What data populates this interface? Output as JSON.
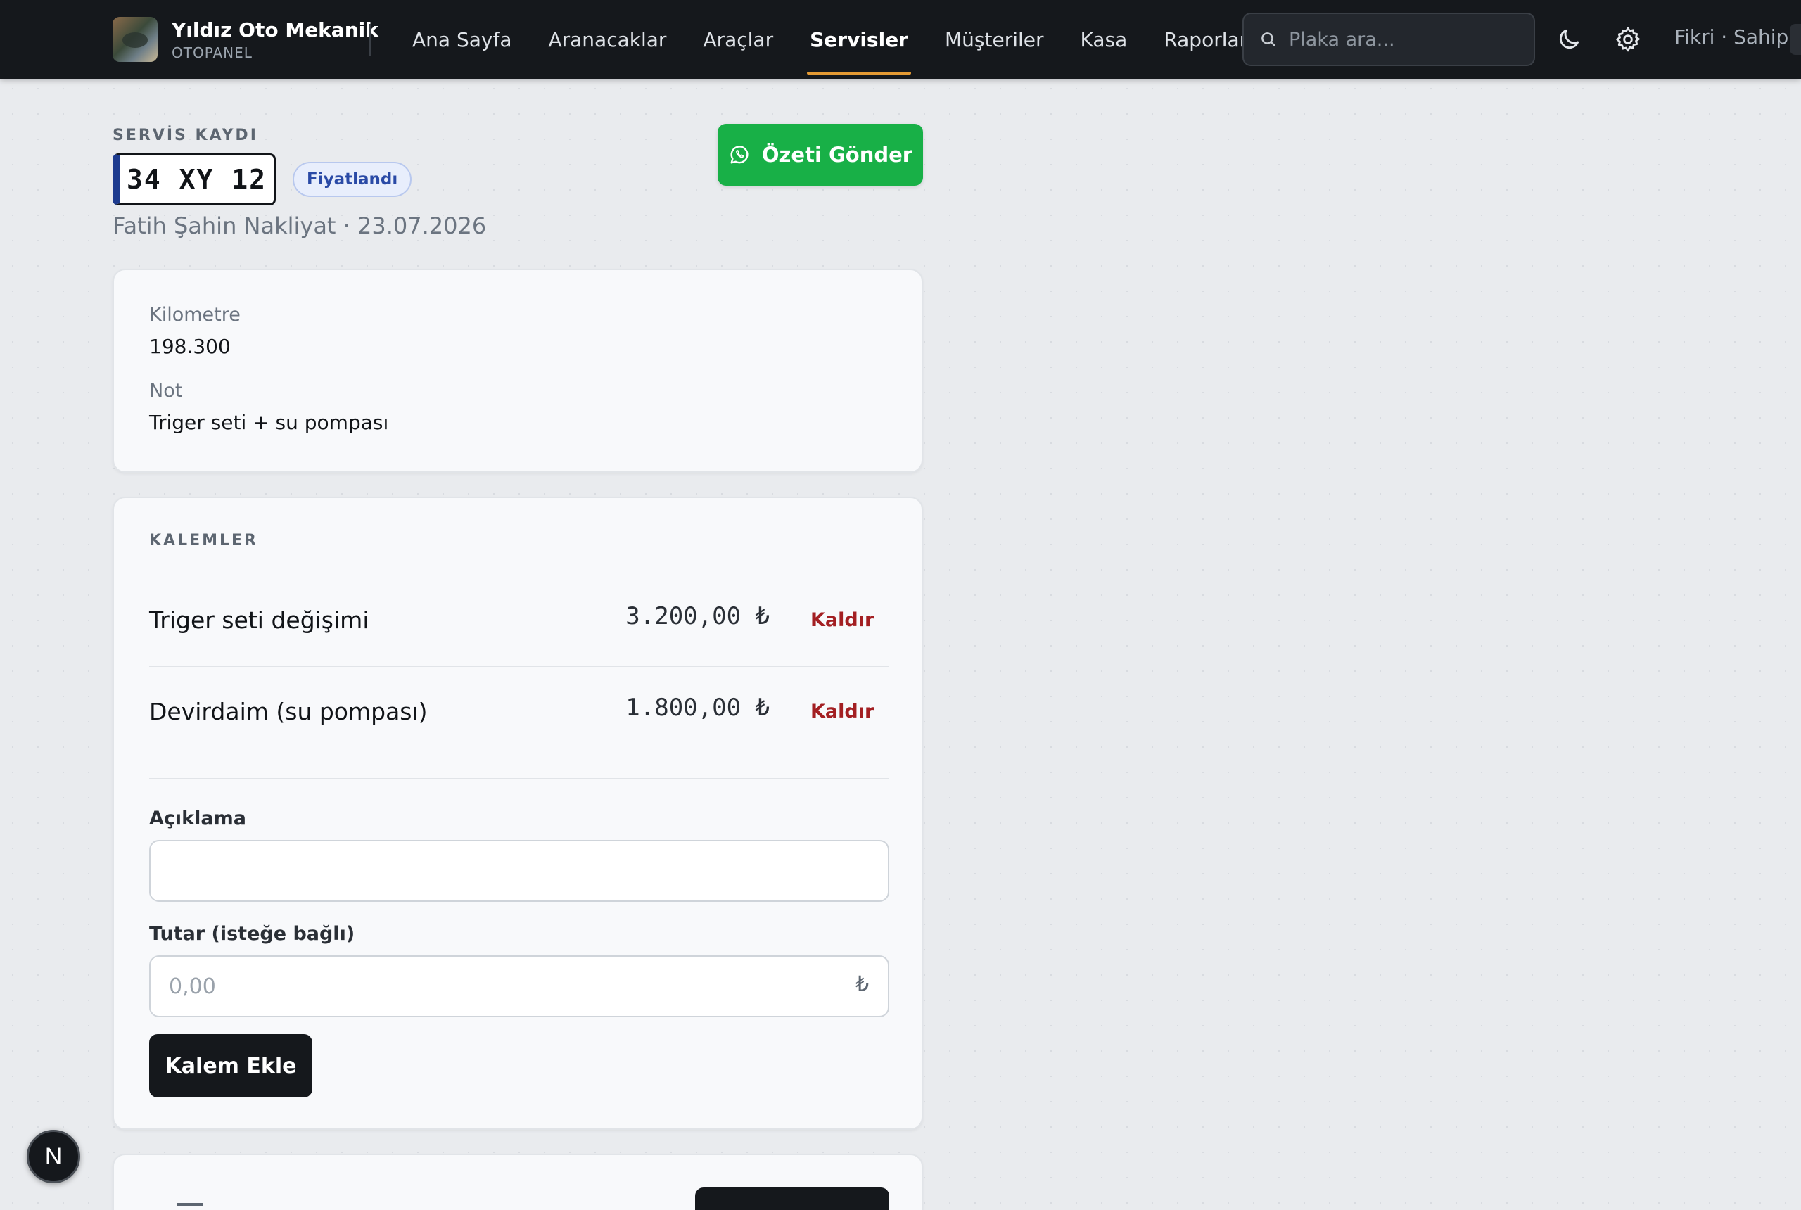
{
  "brand": {
    "name": "Yıldız Oto Mekanik",
    "subtitle": "OTOPANEL"
  },
  "nav": {
    "items": [
      {
        "label": "Ana Sayfa"
      },
      {
        "label": "Aranacaklar"
      },
      {
        "label": "Araçlar"
      },
      {
        "label": "Servisler",
        "active": true
      },
      {
        "label": "Müşteriler"
      },
      {
        "label": "Kasa"
      },
      {
        "label": "Raporlar"
      }
    ]
  },
  "search": {
    "placeholder": "Plaka ara..."
  },
  "user": {
    "label": "Fikri · Sahip"
  },
  "icons": {
    "theme": "moon-icon",
    "settings": "gear-icon",
    "search": "search-icon",
    "whatsapp": "whatsapp-icon"
  },
  "header": {
    "eyebrow": "SERVİS KAYDI",
    "plate": "34 XY 12",
    "status": "Fiyatlandı",
    "subline": "Fatih Şahin Nakliyat · 23.07.2026",
    "send_summary_label": "Özeti Gönder"
  },
  "info": {
    "km_label": "Kilometre",
    "km_value": "198.300",
    "note_label": "Not",
    "note_value": "Triger seti + su pompası"
  },
  "items": {
    "title": "KALEMLER",
    "rows": [
      {
        "description": "Triger seti değişimi",
        "amount": "3.200,00 ₺",
        "remove_label": "Kaldır"
      },
      {
        "description": "Devirdaim (su pompası)",
        "amount": "1.800,00 ₺",
        "remove_label": "Kaldır"
      }
    ],
    "form": {
      "description_label": "Açıklama",
      "description_value": "",
      "amount_label": "Tutar (isteğe bağlı)",
      "amount_placeholder": "0,00",
      "currency": "₺",
      "add_label": "Kalem Ekle"
    }
  },
  "colors": {
    "accent": "#e39a34",
    "whatsapp": "#18b047",
    "danger": "#a31f22",
    "topbar": "#15181c"
  },
  "fab": {
    "label": "N"
  }
}
